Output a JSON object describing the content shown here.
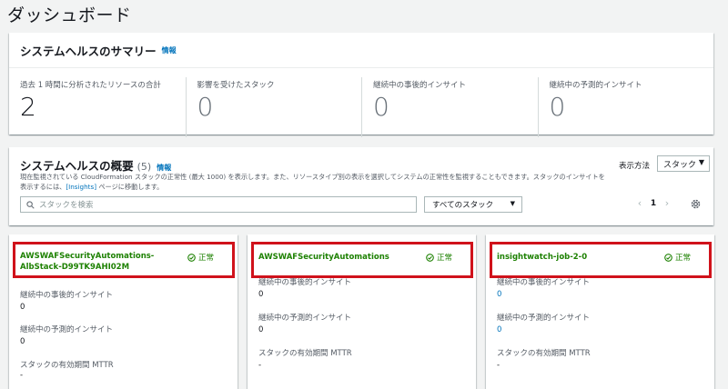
{
  "page": {
    "title": "ダッシュボード"
  },
  "health_summary": {
    "title": "システムヘルスのサマリー",
    "info": "情報",
    "metrics": [
      {
        "label": "過去 1 時間に分析されたリソースの合計",
        "value": "2"
      },
      {
        "label": "影響を受けたスタック",
        "value": "0"
      },
      {
        "label": "継続中の事後的インサイト",
        "value": "0"
      },
      {
        "label": "継続中の予測的インサイト",
        "value": "0"
      }
    ]
  },
  "overview": {
    "title": "システムヘルスの概要",
    "count": "(5)",
    "info": "情報",
    "description_1": "現在監視されている CloudFormation スタックの正常性 (最大 1000) を表示します。また、リソースタイプ別の表示を選択してシステムの正常性を監視することもできます。スタックのインサイトを",
    "description_2a": "表示するには、",
    "description_link": "[Insights]",
    "description_2b": " ページに移動します。",
    "display_label": "表示方法",
    "display_value": "スタック",
    "search_placeholder": "スタックを検索",
    "filter_value": "すべてのスタック",
    "page_number": "1"
  },
  "cards": [
    {
      "name": "AWSWAFSecurityAutomations-AlbStack-D99TK9AHI02M",
      "status": "正常",
      "reactive_label": "継続中の事後的インサイト",
      "reactive_value": "0",
      "proactive_label": "継続中の予測的インサイト",
      "proactive_value": "0",
      "mttr_label": "スタックの有効期間 MTTR",
      "mttr_value": "-"
    },
    {
      "name": "AWSWAFSecurityAutomations",
      "status": "正常",
      "reactive_label": "継続中の事後的インサイト",
      "reactive_value": "0",
      "proactive_label": "継続中の予測的インサイト",
      "proactive_value": "0",
      "mttr_label": "スタックの有効期間 MTTR",
      "mttr_value": "-"
    },
    {
      "name": "insightwatch-job-2-0",
      "status": "正常",
      "reactive_label": "継続中の事後的インサイト",
      "reactive_value": "0",
      "proactive_label": "継続中の予測的インサイト",
      "proactive_value": "0",
      "mttr_label": "スタックの有効期間 MTTR",
      "mttr_value": "-"
    }
  ],
  "colors": {
    "healthy": "#1d8102",
    "link": "#0073bb",
    "highlight_border": "#d0121b"
  },
  "icons": {
    "search": "search-icon",
    "status": "check-circle-icon",
    "settings": "gear-icon",
    "prev": "chevron-left-icon",
    "next": "chevron-right-icon",
    "dropdown": "caret-down-icon"
  }
}
